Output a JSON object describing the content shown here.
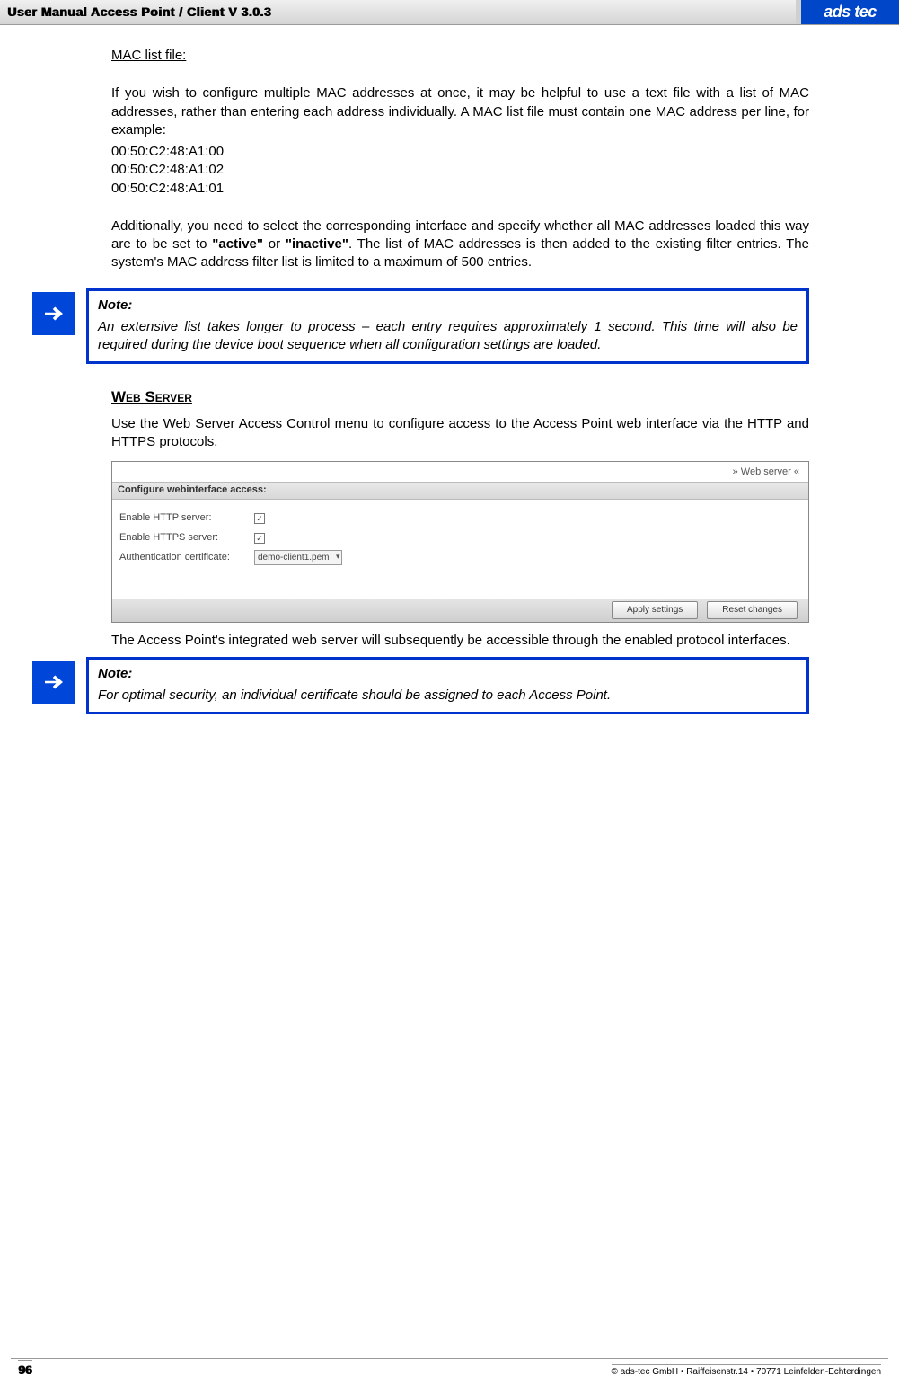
{
  "header": {
    "title": "User Manual Access Point / Client V 3.0.3",
    "logo": "ads tec"
  },
  "mac_section": {
    "heading": "MAC list file:",
    "intro": "If you wish to configure multiple MAC addresses at once, it may be helpful to use a text file with a list of MAC addresses, rather than entering each address individually. A MAC list file must contain one MAC address per line, for example:",
    "examples": [
      "00:50:C2:48:A1:00",
      "00:50:C2:48:A1:02",
      "00:50:C2:48:A1:01"
    ],
    "para2_pre": "Additionally, you need to select the corresponding interface and specify whether all MAC addresses loaded this way are to be set to ",
    "active": "\"active\"",
    "mid": " or ",
    "inactive": "\"inactive\"",
    "para2_post": ". The list of MAC addresses is then added to the existing filter entries. The system's MAC address filter list is limited to a maximum of 500 entries."
  },
  "note1": {
    "label": "Note:",
    "text": "An extensive list takes longer to process – each entry requires approximately 1 second. This time will also be required during the device boot sequence when all configuration settings are loaded."
  },
  "web_section": {
    "heading": "Web Server",
    "para1": "Use the Web Server Access Control menu to configure access to the Access Point web interface via the HTTP and HTTPS protocols.",
    "para2": "The Access Point's integrated web server will subsequently be accessible through the enabled protocol interfaces."
  },
  "screenshot": {
    "breadcrumb": "» Web server «",
    "grey_title": "Configure webinterface access:",
    "rows": {
      "http_label": "Enable HTTP server:",
      "https_label": "Enable HTTPS server:",
      "cert_label": "Authentication certificate:",
      "cert_value": "demo-client1.pem"
    },
    "buttons": {
      "apply": "Apply settings",
      "reset": "Reset changes"
    }
  },
  "note2": {
    "label": "Note:",
    "text": "For optimal security, an individual certificate should be assigned to each Access Point."
  },
  "footer": {
    "page": "96",
    "copyright": "© ads-tec GmbH • Raiffeisenstr.14 • 70771 Leinfelden-Echterdingen"
  }
}
